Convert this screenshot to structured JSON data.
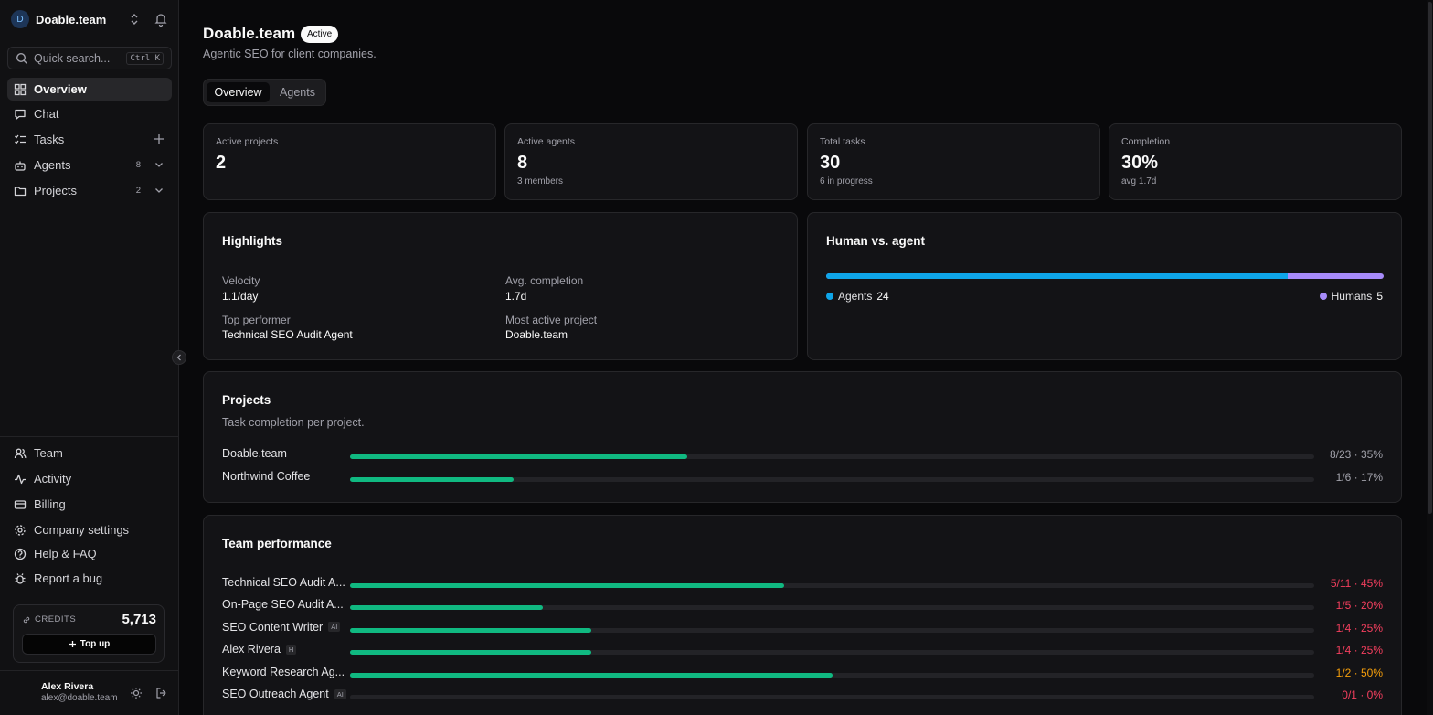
{
  "workspace": {
    "initial": "D",
    "name": "Doable.team"
  },
  "search": {
    "placeholder": "Quick search...",
    "shortcut": "Ctrl K"
  },
  "nav": [
    {
      "label": "Overview",
      "icon": "grid-icon"
    },
    {
      "label": "Chat",
      "icon": "message-icon"
    },
    {
      "label": "Tasks",
      "icon": "list-check-icon"
    },
    {
      "label": "Agents",
      "icon": "bot-icon",
      "count": "8"
    },
    {
      "label": "Projects",
      "icon": "folder-icon",
      "count": "2"
    }
  ],
  "bottom_nav": [
    {
      "label": "Team",
      "icon": "users-icon"
    },
    {
      "label": "Activity",
      "icon": "activity-icon"
    },
    {
      "label": "Billing",
      "icon": "card-icon"
    },
    {
      "label": "Company settings",
      "icon": "gear-icon"
    },
    {
      "label": "Help & FAQ",
      "icon": "help-icon"
    },
    {
      "label": "Report a bug",
      "icon": "bug-icon"
    }
  ],
  "credits": {
    "label": "CREDITS",
    "value": "5,713",
    "topup_label": "Top up"
  },
  "user": {
    "name": "Alex Rivera",
    "email": "alex@doable.team"
  },
  "header": {
    "title": "Doable.team",
    "status": "Active",
    "subtitle": "Agentic SEO for client companies."
  },
  "tabs": [
    "Overview",
    "Agents"
  ],
  "stats": [
    {
      "label": "Active projects",
      "value": "2",
      "sub": ""
    },
    {
      "label": "Active agents",
      "value": "8",
      "sub": "3 members"
    },
    {
      "label": "Total tasks",
      "value": "30",
      "sub": "6 in progress"
    },
    {
      "label": "Completion",
      "value": "30%",
      "sub": "avg 1.7d"
    }
  ],
  "highlights": {
    "title": "Highlights",
    "items": [
      {
        "label": "Velocity",
        "value": "1.1/day"
      },
      {
        "label": "Avg. completion",
        "value": "1.7d"
      },
      {
        "label": "Top performer",
        "value": "Technical SEO Audit Agent"
      },
      {
        "label": "Most active project",
        "value": "Doable.team"
      }
    ]
  },
  "human_vs_agent": {
    "title": "Human vs. agent",
    "agents_label": "Agents",
    "agents": "24",
    "humans_label": "Humans",
    "humans": "5",
    "agents_fraction": 0.828,
    "colors": {
      "agents": "#0ea5e9",
      "humans": "#a78bfa"
    }
  },
  "projects": {
    "title": "Projects",
    "subtitle": "Task completion per project.",
    "rows": [
      {
        "name": "Doable.team",
        "stat": "8/23 · 35%",
        "fraction": 0.35
      },
      {
        "name": "Northwind Coffee",
        "stat": "1/6 · 17%",
        "fraction": 0.17
      }
    ]
  },
  "team": {
    "title": "Team performance",
    "rows": [
      {
        "name": "Technical SEO Audit A...",
        "tag": "",
        "stat": "5/11 · 45%",
        "fraction": 0.45,
        "color": "#f43f5e"
      },
      {
        "name": "On-Page SEO Audit A...",
        "tag": "",
        "stat": "1/5 · 20%",
        "fraction": 0.2,
        "color": "#f43f5e"
      },
      {
        "name": "SEO Content Writer",
        "tag": "AI",
        "stat": "1/4 · 25%",
        "fraction": 0.25,
        "color": "#f43f5e"
      },
      {
        "name": "Alex Rivera",
        "tag": "H",
        "stat": "1/4 · 25%",
        "fraction": 0.25,
        "color": "#f43f5e"
      },
      {
        "name": "Keyword Research Ag...",
        "tag": "",
        "stat": "1/2 · 50%",
        "fraction": 0.5,
        "color": "#f59e0b"
      },
      {
        "name": "SEO Outreach Agent",
        "tag": "AI",
        "stat": "0/1 · 0%",
        "fraction": 0,
        "color": "#f43f5e"
      }
    ]
  },
  "colors": {
    "accent": "#10b981",
    "danger": "#f43f5e",
    "warning": "#f59e0b"
  }
}
